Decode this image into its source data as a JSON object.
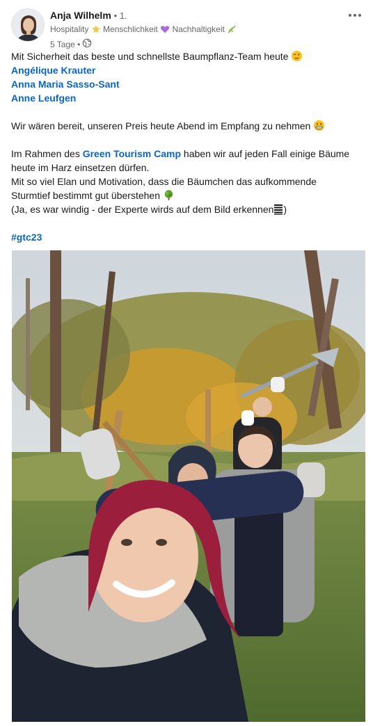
{
  "author": {
    "name": "Anja Wilhelm",
    "degree": "• 1.",
    "headline_parts": [
      "Hospitality",
      "Menschlichkeit",
      "Nachhaltigkeit"
    ],
    "time": "5 Tage •"
  },
  "post": {
    "line1": "Mit Sicherheit das beste und schnellste Baumpflanz-Team heute",
    "mentions": [
      "Angélique Krauter",
      "Anna Maria Sasso-Sant",
      "Anne Leufgen"
    ],
    "line2": "Wir wären bereit, unseren Preis heute Abend im Empfang zu nehmen",
    "line3_before": "Im Rahmen des ",
    "line3_link": "Green Tourism Camp",
    "line3_after": " haben wir auf jeden Fall einige Bäume",
    "line4": "heute im Harz einsetzen dürfen.",
    "line5": "Mit so viel Elan und Motivation, dass die Bäumchen das aufkommende",
    "line6": "Sturmtief bestimmt gut überstehen",
    "line7": "(Ja, es war windig - der Experte wirds auf dem Bild erkennen",
    "line7_end": ")",
    "hashtag": "#gtc23"
  },
  "icons": {
    "more": "more-horizontal-icon",
    "visibility": "globe-icon",
    "star": "star-emoji",
    "heart": "purple-heart-emoji",
    "herb": "herb-emoji",
    "wink": "winking-face-emoji",
    "grin": "grimacing-face-emoji",
    "tree": "tree-emoji",
    "stack": "stacked-lines-symbol"
  },
  "colors": {
    "link": "#0a66c2",
    "text": "#191919",
    "muted": "#666666"
  }
}
